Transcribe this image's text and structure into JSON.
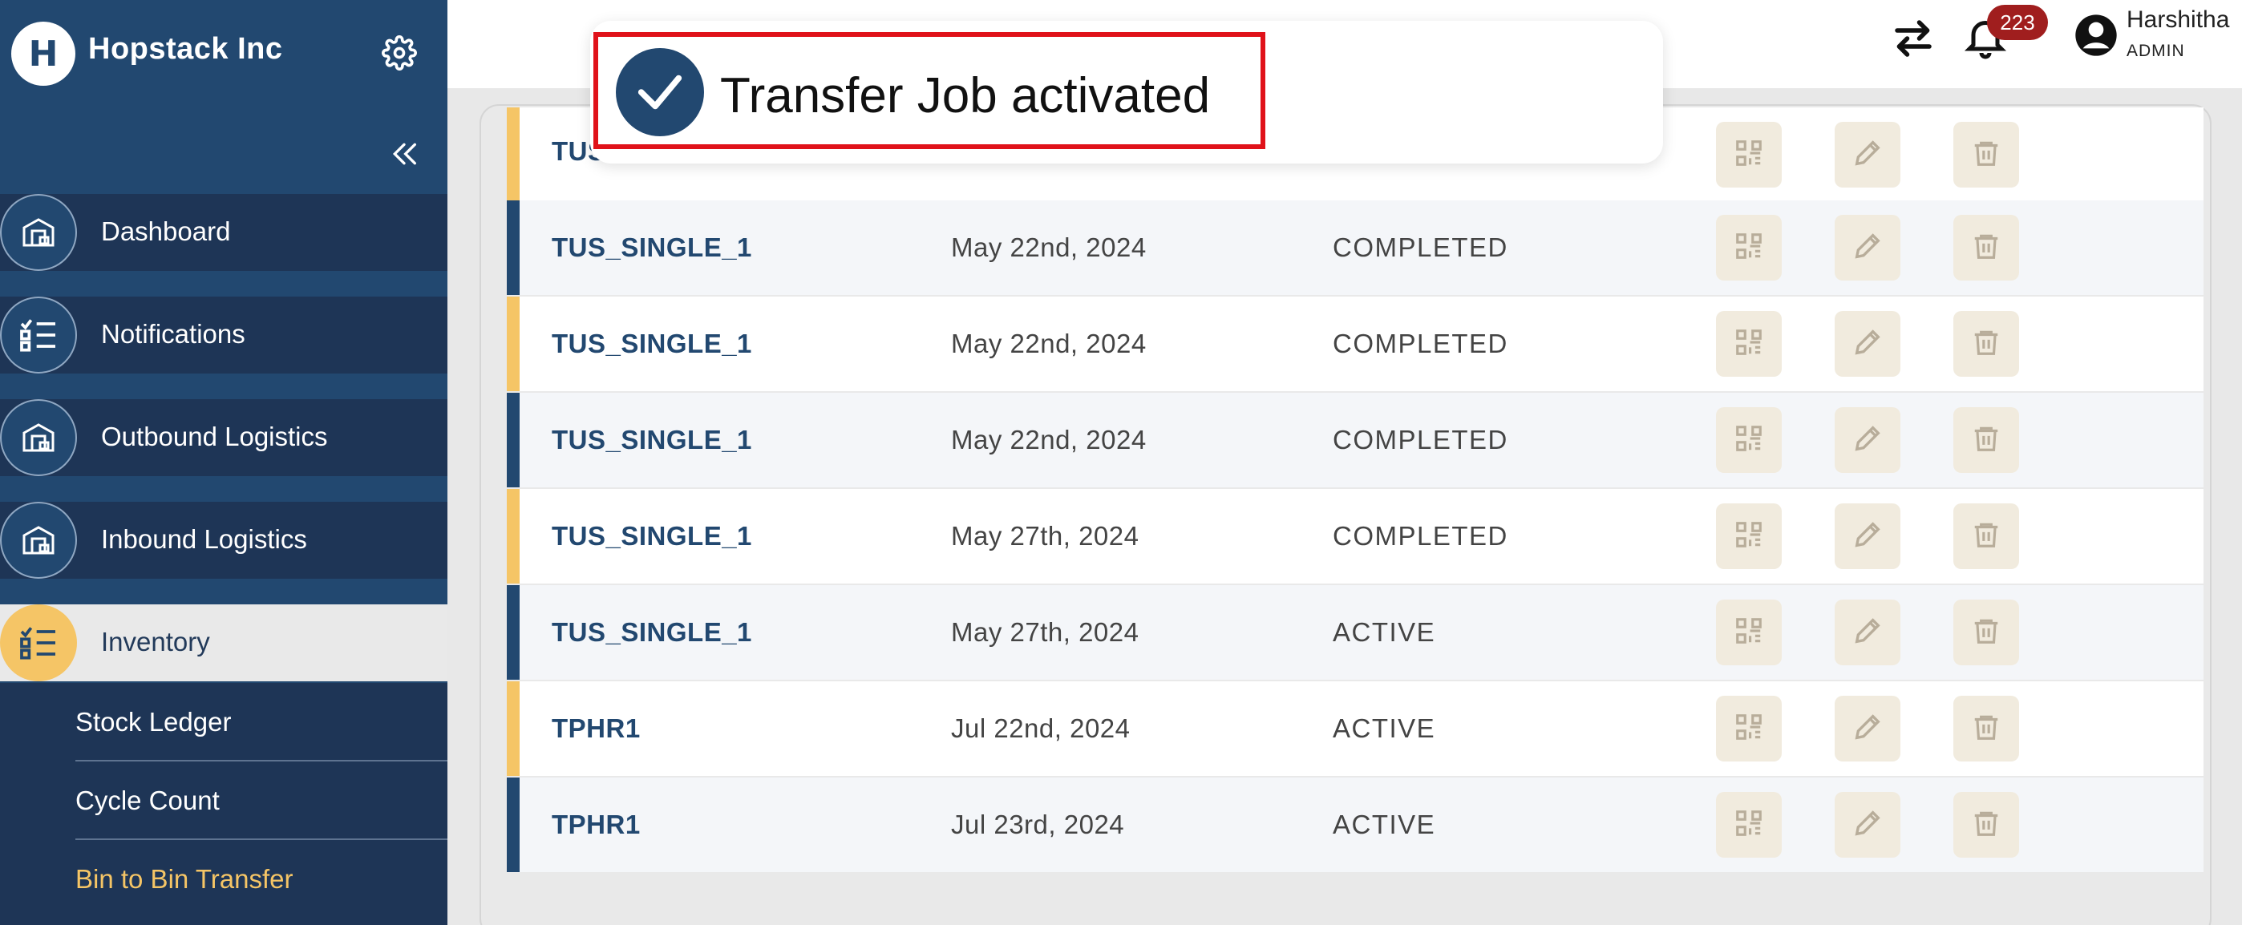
{
  "brand": {
    "logo_letter": "H",
    "name": "Hopstack Inc"
  },
  "nav": [
    {
      "label": "Dashboard",
      "icon": "warehouse-icon",
      "active": false
    },
    {
      "label": "Notifications",
      "icon": "checklist-icon",
      "active": false
    },
    {
      "label": "Outbound Logistics",
      "icon": "warehouse-icon",
      "active": false
    },
    {
      "label": "Inbound Logistics",
      "icon": "warehouse-icon",
      "active": false
    },
    {
      "label": "Inventory",
      "icon": "checklist-icon",
      "active": true
    }
  ],
  "subnav": [
    {
      "label": "Stock Ledger",
      "current": false
    },
    {
      "label": "Cycle Count",
      "current": false
    },
    {
      "label": "Bin to Bin Transfer",
      "current": true
    }
  ],
  "topbar": {
    "notification_count": "223",
    "user_name": "Harshitha",
    "user_role": "ADMIN"
  },
  "toast": {
    "message": "Transfer Job activated"
  },
  "rows": [
    {
      "name": "TUS_SINGLE_1",
      "date": "May 22nd, 2024",
      "status": "COMPLETED",
      "accent": "#224870"
    },
    {
      "name": "TUS_SINGLE_1",
      "date": "May 22nd, 2024",
      "status": "COMPLETED",
      "accent": "#f5c566"
    },
    {
      "name": "TUS_SINGLE_1",
      "date": "May 22nd, 2024",
      "status": "COMPLETED",
      "accent": "#224870"
    },
    {
      "name": "TUS_SINGLE_1",
      "date": "May 27th, 2024",
      "status": "COMPLETED",
      "accent": "#f5c566"
    },
    {
      "name": "TUS_SINGLE_1",
      "date": "May 27th, 2024",
      "status": "ACTIVE",
      "accent": "#224870"
    },
    {
      "name": "TPHR1",
      "date": "Jul 22nd, 2024",
      "status": "ACTIVE",
      "accent": "#f5c566"
    },
    {
      "name": "TPHR1",
      "date": "Jul 23rd, 2024",
      "status": "ACTIVE",
      "accent": "#224870"
    }
  ],
  "partial_row": {
    "name": "TUS",
    "accent": "#f5c566"
  },
  "colors": {
    "primary": "#224870",
    "accent": "#f5c566",
    "toast_border": "#e0121a",
    "badge": "#a01e1e"
  }
}
